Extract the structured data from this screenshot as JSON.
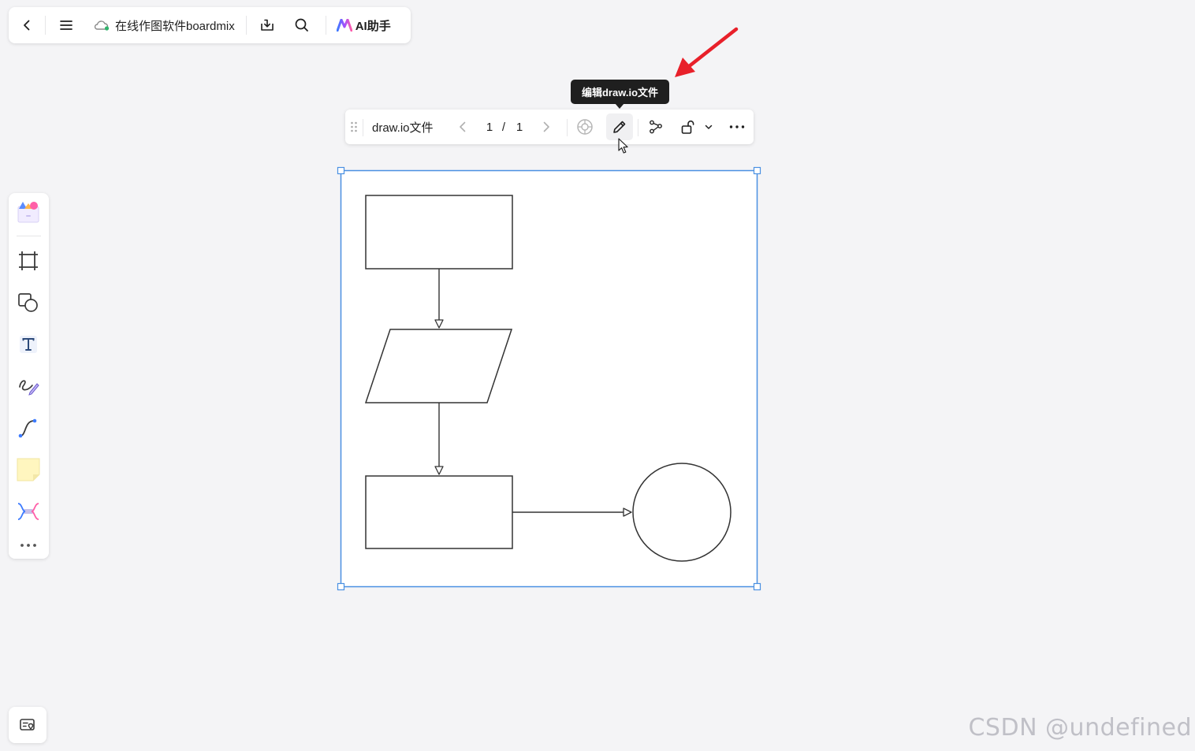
{
  "topbar": {
    "back_icon": "chevron-left-icon",
    "menu_icon": "hamburger-menu-icon",
    "cloud_icon": "cloud-sync-icon",
    "doc_title": "在线作图软件boardmix",
    "download_icon": "download-icon",
    "search_icon": "search-icon",
    "ai_icon": "ai-logo-icon",
    "ai_label": "AI助手"
  },
  "left_toolbar": {
    "items": [
      {
        "name": "templates",
        "icon": "template-library-icon"
      },
      {
        "name": "frame",
        "icon": "frame-icon"
      },
      {
        "name": "shapes",
        "icon": "shapes-icon"
      },
      {
        "name": "text",
        "icon": "text-icon"
      },
      {
        "name": "pen",
        "icon": "pen-draw-icon"
      },
      {
        "name": "connector",
        "icon": "connector-line-icon"
      },
      {
        "name": "sticky-note",
        "icon": "sticky-note-icon"
      },
      {
        "name": "mindmap",
        "icon": "mindmap-icon"
      },
      {
        "name": "more",
        "icon": "more-horizontal-icon"
      }
    ]
  },
  "bottom_left": {
    "icon": "minimap-icon"
  },
  "float_toolbar": {
    "drag_icon": "drag-handle-icon",
    "name": "draw.io文件",
    "prev_icon": "chevron-left-icon",
    "page_current": "1",
    "page_sep": "/",
    "page_total": "1",
    "next_icon": "chevron-right-icon",
    "drawio_icon": "drawio-logo-icon",
    "edit_icon": "pencil-edit-icon",
    "connect_icon": "connection-nodes-icon",
    "lock_icon": "unlock-icon",
    "lock_dropdown_icon": "chevron-down-icon",
    "more_icon": "more-horizontal-icon"
  },
  "tooltip": {
    "text": "编辑draw.io文件"
  },
  "annotation": {
    "arrow_color": "#e8202a"
  },
  "colors": {
    "selection": "#4a90e2",
    "shape_stroke": "#333333",
    "canvas_bg": "#f4f4f6"
  },
  "watermark": {
    "text": "CSDN @undefined"
  }
}
